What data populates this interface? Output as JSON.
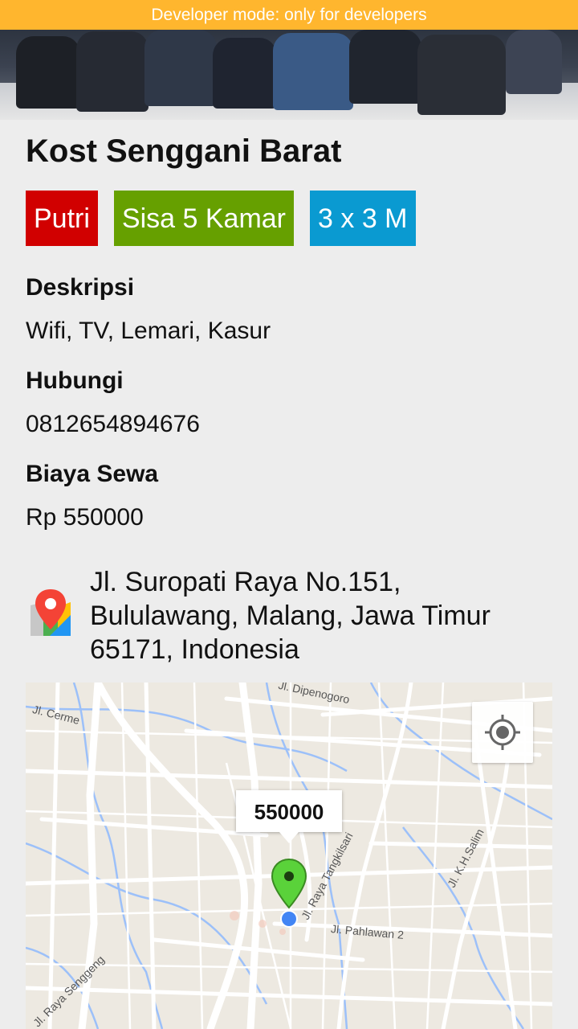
{
  "banner": {
    "text": "Developer mode: only for developers"
  },
  "listing": {
    "title": "Kost Senggani Barat",
    "tags": {
      "gender": "Putri",
      "rooms": "Sisa 5 Kamar",
      "size": "3 x 3 M"
    },
    "description_label": "Deskripsi",
    "description_value": "Wifi,  TV,  Lemari,  Kasur",
    "contact_label": "Hubungi",
    "contact_value": "0812654894676",
    "price_label": "Biaya Sewa",
    "price_value": "Rp 550000",
    "address": "Jl. Suropati Raya No.151, Bululawang, Malang, Jawa Timur 65171, Indonesia"
  },
  "map": {
    "marker_label": "550000",
    "streets": {
      "s1": "Jl. Dipenogoro",
      "s2": "Jl. Cerme",
      "s3": "Jl. Raya Tangkilsari",
      "s4": "Jl. K.H.Salim",
      "s5": "Jl. Pahlawan 2",
      "s6": "Jl. Raya Senggeng"
    },
    "colors": {
      "marker": "#5ad23a",
      "my_location": "#4285f4",
      "water": "#9cc0f9"
    }
  },
  "colors": {
    "banner": "#ffb62e",
    "tag_red": "#d10000",
    "tag_green": "#66a000",
    "tag_blue": "#0a9ad1"
  }
}
